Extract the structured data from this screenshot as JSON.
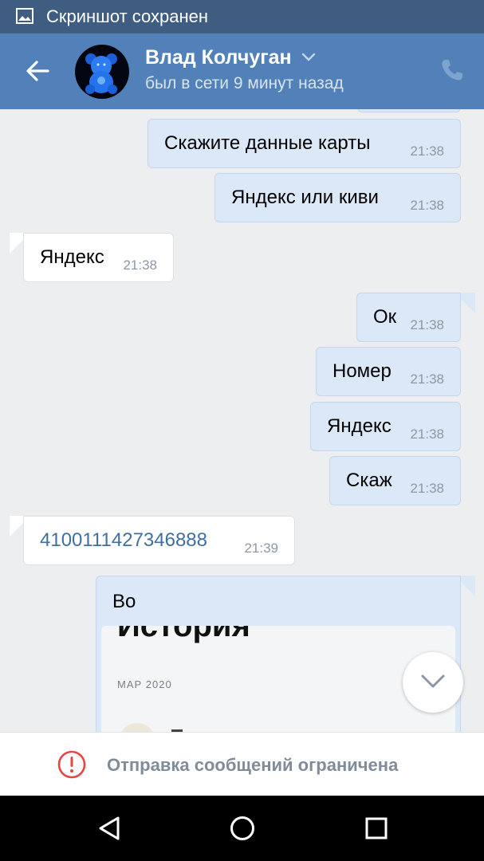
{
  "status_bar": {
    "text": "Скриншот сохранен",
    "icon": "image-icon"
  },
  "header": {
    "name": "Влад Колчуган",
    "status": "был в сети 9 минут назад",
    "accent": "#5181b8"
  },
  "messages": [
    {
      "dir": "out",
      "text": "Скажите данные карты",
      "time": "21:38"
    },
    {
      "dir": "out",
      "text": "Яндекс или киви",
      "time": "21:38"
    },
    {
      "dir": "in",
      "text": "Яндекс",
      "time": "21:38"
    },
    {
      "dir": "out",
      "text": "Ок",
      "time": "21:38"
    },
    {
      "dir": "out",
      "text": "Номер",
      "time": "21:38"
    },
    {
      "dir": "out",
      "text": "Яндекс",
      "time": "21:38"
    },
    {
      "dir": "out",
      "text": "Скаж",
      "time": "21:38"
    },
    {
      "dir": "in",
      "text": "4100111427346888",
      "time": "21:39"
    }
  ],
  "attachment_message": {
    "text": "Во",
    "card_title": "История",
    "card_date": "МАР 2020"
  },
  "restriction": {
    "text": "Отправка сообщений ограничена",
    "color": "#e64646"
  },
  "nav": [
    "back-triangle-icon",
    "home-circle-icon",
    "recents-square-icon"
  ]
}
